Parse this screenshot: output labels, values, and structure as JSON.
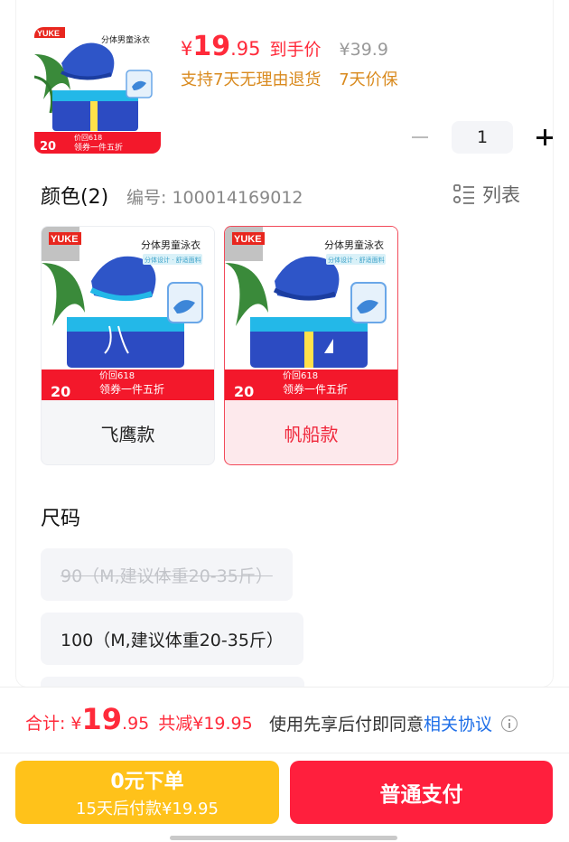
{
  "product": {
    "image_label": "分体男童泳衣",
    "brand_badge": "YUKE",
    "promo_price": "20",
    "promo_tag": "领券一件五折",
    "promo_618": "价回618",
    "price_symbol": "¥",
    "price_int": "19",
    "price_dec": ".95",
    "price_label": "到手价",
    "original_price": "¥39.9",
    "services": [
      "支持7天无理由退货",
      "7天价保"
    ]
  },
  "quantity": {
    "value": "1"
  },
  "color_section": {
    "title": "颜色(2)",
    "sku_number": "编号: 100014169012",
    "view_toggle": "列表",
    "variants": [
      {
        "label": "飞鹰款",
        "selected": false,
        "image_title": "分体男童泳衣",
        "image_sub": "分体设计 · 舒适面料",
        "badge": "YUKE",
        "promo_price": "20",
        "promo_tag": "领券一件五折",
        "promo_618": "价回618"
      },
      {
        "label": "帆船款",
        "selected": true,
        "image_title": "分体男童泳衣",
        "image_sub": "分体设计 · 舒适面料",
        "badge": "YUKE",
        "promo_price": "20",
        "promo_tag": "领券一件五折",
        "promo_618": "价回618"
      }
    ]
  },
  "size_section": {
    "title": "尺码",
    "options": [
      {
        "label": "90（M,建议体重20-35斤）",
        "disabled": true
      },
      {
        "label": "100（M,建议体重20-35斤）",
        "disabled": false
      }
    ]
  },
  "bottom_bar": {
    "total_label": "合计:",
    "total_symbol": "¥",
    "total_int": "19",
    "total_dec": ".95",
    "discount": "共减¥19.95",
    "agree_text": "使用先享后付即同意",
    "agree_link": "相关协议",
    "later_button_line1": "0元下单",
    "later_button_line2": "15天后付款¥19.95",
    "pay_button": "普通支付"
  },
  "colors": {
    "price_red": "#ff2a3a",
    "service_orange": "#d98a1e",
    "link_blue": "#1f6fe8",
    "later_yellow": "#ffc21a",
    "pay_red": "#ff1f3d"
  }
}
